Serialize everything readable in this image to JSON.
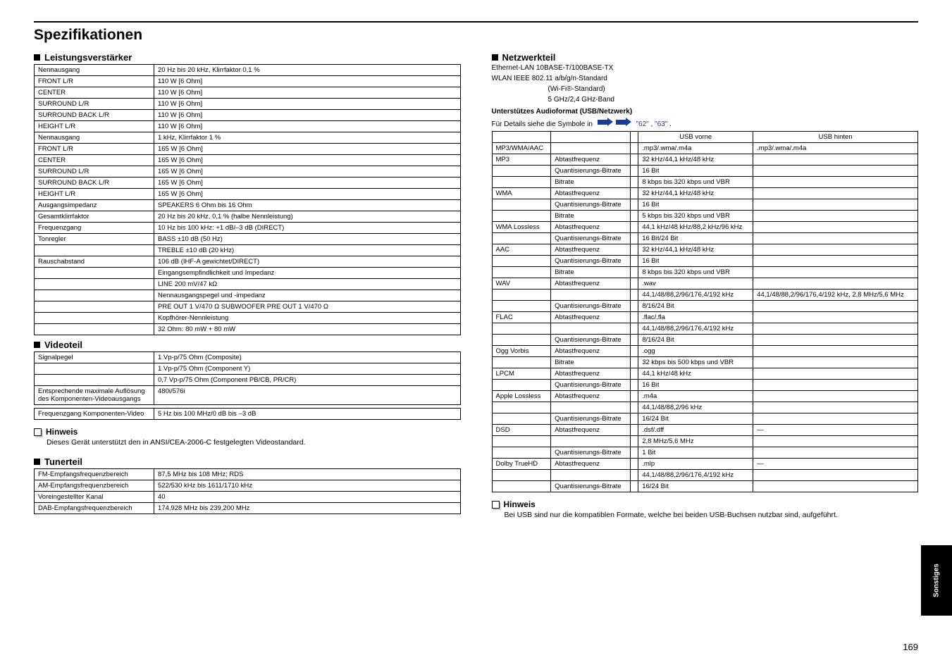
{
  "page_title": "Spezifikationen",
  "side_tab": "Sonstiges",
  "page_number": "169",
  "sections": {
    "amplifier": {
      "title": "Leistungsverstärker",
      "rows": [
        [
          "Nennausgang",
          "20 Hz bis 20 kHz, Klirrfaktor 0,1 %"
        ],
        [
          "FRONT L/R",
          "110 W [6 Ohm]"
        ],
        [
          "CENTER",
          "110 W [6 Ohm]"
        ],
        [
          "SURROUND L/R",
          "110 W [6 Ohm]"
        ],
        [
          "SURROUND BACK L/R",
          "110 W [6 Ohm]"
        ],
        [
          "HEIGHT L/R",
          "110 W [6 Ohm]"
        ],
        [
          "Nennausgang",
          "1 kHz, Klirrfaktor 1 %"
        ],
        [
          "FRONT L/R",
          "165 W [6 Ohm]"
        ],
        [
          "CENTER",
          "165 W [6 Ohm]"
        ],
        [
          "SURROUND L/R",
          "165 W [6 Ohm]"
        ],
        [
          "SURROUND BACK L/R",
          "165 W [6 Ohm]"
        ],
        [
          "HEIGHT L/R",
          "165 W [6 Ohm]"
        ],
        [
          "Ausgangsimpedanz",
          "SPEAKERS 6 Ohm bis 16 Ohm"
        ],
        [
          "Gesamtklirrfaktor",
          "20 Hz bis 20 kHz, 0,1 % (halbe Nennleistung)"
        ],
        [
          "Frequenzgang",
          "10 Hz bis 100 kHz: +1 dB/–3 dB (DIRECT)"
        ],
        [
          "Tonregler",
          "BASS  ±10 dB (50 Hz)"
        ],
        [
          "",
          "TREBLE  ±10 dB (20 kHz)"
        ],
        [
          "Rauschabstand",
          "106 dB (IHF-A gewichtet/DIRECT)"
        ],
        [
          "",
          "Eingangsempfindlichkeit und Impedanz"
        ],
        [
          "",
          "LINE  200 mV/47 kΩ"
        ],
        [
          "",
          "Nennausgangspegel und -impedanz"
        ],
        [
          "",
          "PRE OUT  1 V/470 Ω  SUBWOOFER PRE OUT  1 V/470 Ω"
        ],
        [
          "",
          "Kopfhörer-Nennleistung"
        ],
        [
          "",
          "32 Ohm: 80 mW + 80 mW"
        ]
      ]
    },
    "video": {
      "title": "Videoteil",
      "rows": [
        [
          "Signalpegel",
          "1 Vp-p/75 Ohm (Composite)"
        ],
        [
          "",
          "1 Vp-p/75 Ohm (Component Y)"
        ],
        [
          "",
          "0,7 Vp-p/75 Ohm (Component PB/CB, PR/CR)"
        ],
        [
          "Entsprechende maximale Auflösung des Komponenten-Videoausgangs",
          "480i/576i"
        ]
      ],
      "extra": [
        [
          "Frequenzgang Komponenten-Video",
          "5 Hz bis 100 MHz/0 dB bis –3 dB"
        ]
      ]
    },
    "tuner": {
      "title": "Tunerteil",
      "rows": [
        [
          "FM-Empfangsfrequenzbereich",
          "87,5 MHz bis 108 MHz; RDS"
        ],
        [
          "AM-Empfangsfrequenzbereich",
          "522/530 kHz bis 1611/1710 kHz"
        ],
        [
          "Voreingestellter Kanal",
          "40"
        ],
        [
          "DAB-Empfangsfrequenzbereich",
          "174,928 MHz bis 239,200 MHz"
        ]
      ]
    },
    "network": {
      "title": "Netzwerkteil",
      "intro_lines": [
        "Ethernet-LAN  10BASE-T/100BASE-TX",
        "WLAN  IEEE 802.11 a/b/g/n-Standard",
        "(Wi-Fi®-Standard)",
        "5 GHz/2,4 GHz-Band"
      ],
      "format_heading": "Unterstützes Audioformat (USB/Netzwerk)"
    },
    "usb": {
      "header": [
        "",
        "",
        "",
        "USB vorne",
        "USB hinten"
      ],
      "rows": [
        [
          "MP3/WMA/AAC",
          "",
          "",
          ".mp3/.wma/.m4a",
          ".mp3/.wma/.m4a"
        ],
        [
          "MP3",
          "Abtastfrequenz",
          "",
          "32 kHz/44,1 kHz/48 kHz",
          ""
        ],
        [
          "",
          "Quantisierungs-Bitrate",
          "",
          "16 Bit",
          ""
        ],
        [
          "",
          "Bitrate",
          "",
          "8 kbps bis 320 kbps und VBR",
          ""
        ],
        [
          "WMA",
          "Abtastfrequenz",
          "",
          "32 kHz/44,1 kHz/48 kHz",
          ""
        ],
        [
          "",
          "Quantisierungs-Bitrate",
          "",
          "16 Bit",
          ""
        ],
        [
          "",
          "Bitrate",
          "",
          "5 kbps bis 320 kbps und VBR",
          ""
        ],
        [
          "WMA Lossless",
          "Abtastfrequenz",
          "",
          "44,1 kHz/48 kHz/88,2 kHz/96 kHz",
          ""
        ],
        [
          "",
          "Quantisierungs-Bitrate",
          "",
          "16 Bit/24 Bit",
          ""
        ],
        [
          "AAC",
          "Abtastfrequenz",
          "",
          "32 kHz/44,1 kHz/48 kHz",
          ""
        ],
        [
          "",
          "Quantisierungs-Bitrate",
          "",
          "16 Bit",
          ""
        ],
        [
          "",
          "Bitrate",
          "",
          "8 kbps bis 320 kbps und VBR",
          ""
        ],
        [
          "WAV",
          "Abtastfrequenz",
          "",
          ".wav",
          ""
        ],
        [
          "",
          "",
          "",
          "44,1/48/88,2/96/176,4/192 kHz",
          "44,1/48/88,2/96/176,4/192 kHz, 2,8 MHz/5,6 MHz"
        ],
        [
          "",
          "Quantisierungs-Bitrate",
          "",
          "8/16/24 Bit",
          ""
        ],
        [
          "FLAC",
          "Abtastfrequenz",
          "",
          ".flac/.fla",
          ""
        ],
        [
          "",
          "",
          "",
          "44,1/48/88,2/96/176,4/192 kHz",
          ""
        ],
        [
          "",
          "Quantisierungs-Bitrate",
          "",
          "8/16/24 Bit",
          ""
        ],
        [
          "Ogg Vorbis",
          "Abtastfrequenz",
          "",
          ".ogg",
          ""
        ],
        [
          "",
          "Bitrate",
          "",
          "32 kbps bis 500 kbps und VBR",
          ""
        ],
        [
          "LPCM",
          "Abtastfrequenz",
          "",
          "44,1 kHz/48 kHz",
          ""
        ],
        [
          "",
          "Quantisierungs-Bitrate",
          "",
          "16 Bit",
          ""
        ],
        [
          "Apple Lossless",
          "Abtastfrequenz",
          "",
          ".m4a",
          ""
        ],
        [
          "",
          "",
          "",
          "44,1/48/88,2/96 kHz",
          ""
        ],
        [
          "",
          "Quantisierungs-Bitrate",
          "",
          "16/24 Bit",
          ""
        ],
        [
          "DSD",
          "Abtastfrequenz",
          "",
          ".dsf/.dff",
          "—"
        ],
        [
          "",
          "",
          "",
          "2,8 MHz/5,6 MHz",
          ""
        ],
        [
          "",
          "Quantisierungs-Bitrate",
          "",
          "1 Bit",
          ""
        ],
        [
          "Dolby TrueHD",
          "Abtastfrequenz",
          "",
          ".mlp",
          "—"
        ],
        [
          "",
          "",
          "",
          "44,1/48/88,2/96/176,4/192 kHz",
          ""
        ],
        [
          "",
          "Quantisierungs-Bitrate",
          "",
          "16/24 Bit",
          ""
        ]
      ]
    },
    "note": {
      "title": "Hinweis",
      "body": "Dieses Gerät unterstützt den in ANSI/CEA-2006-C festgelegten Videostandard."
    },
    "note2": {
      "title": "Hinweis",
      "body": "Bei USB sind nur die kompatiblen Formate, welche bei beiden USB-Buchsen nutzbar sind, aufgeführt."
    }
  },
  "arrow_caption_prefix": "Für Details siehe die Symbole in ",
  "arrow_caption_link1": "\"62\"",
  "arrow_caption_link2": "\"63\"",
  "arrow_caption_suffix": "."
}
